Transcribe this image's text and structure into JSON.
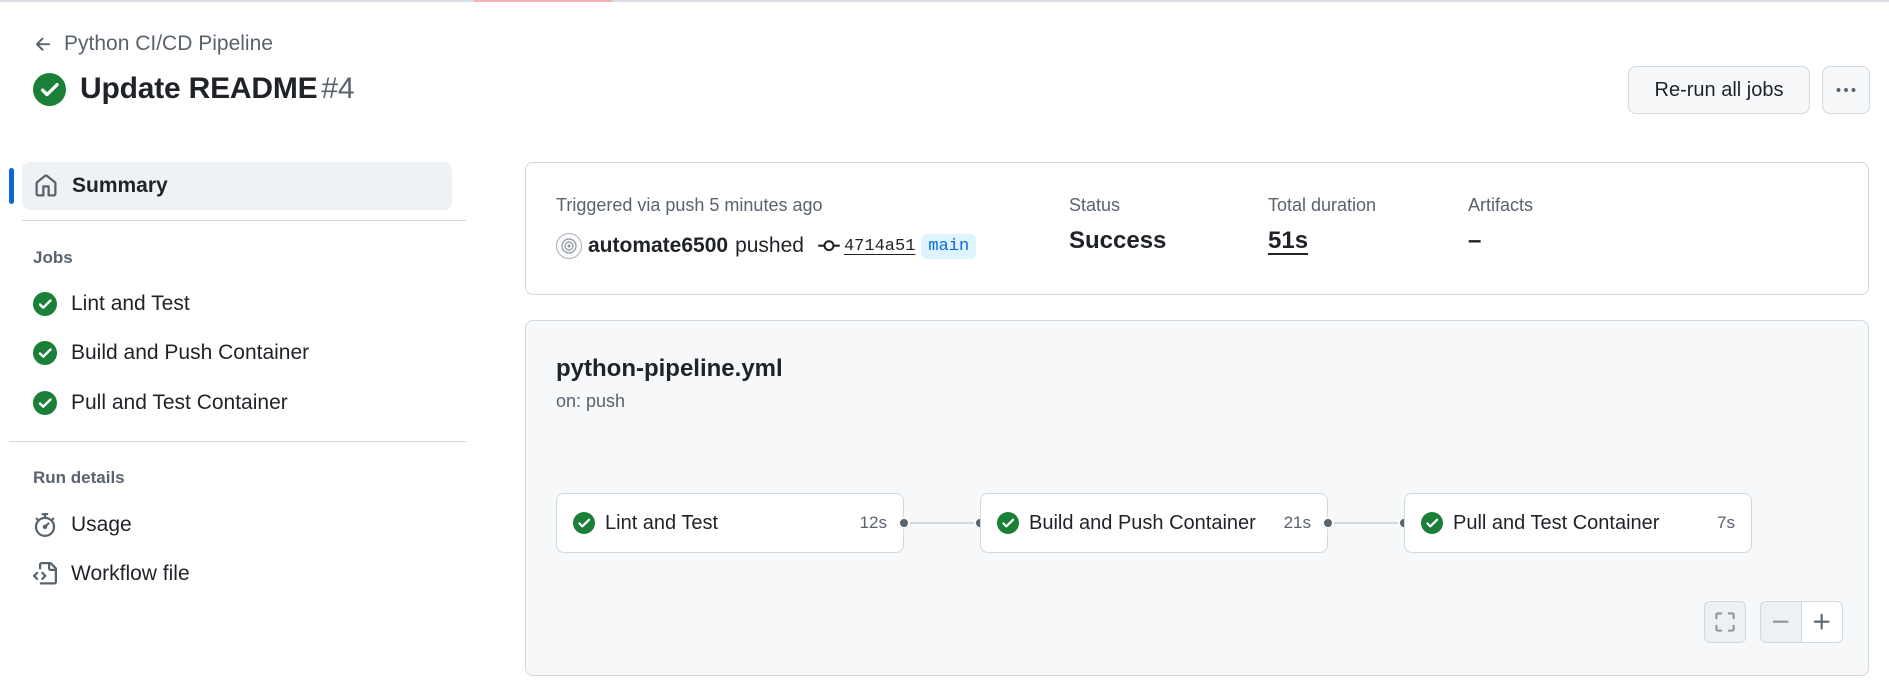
{
  "header": {
    "back_label": "Python CI/CD Pipeline",
    "title": "Update README",
    "run_number": "#4",
    "rerun_label": "Re-run all jobs"
  },
  "sidebar": {
    "summary_label": "Summary",
    "jobs_title": "Jobs",
    "jobs": [
      {
        "label": "Lint and Test"
      },
      {
        "label": "Build and Push Container"
      },
      {
        "label": "Pull and Test Container"
      }
    ],
    "run_details_title": "Run details",
    "run_details": [
      {
        "label": "Usage",
        "icon": "stopwatch-icon"
      },
      {
        "label": "Workflow file",
        "icon": "file-code-icon"
      }
    ]
  },
  "summary": {
    "triggered_text": "Triggered via push 5 minutes ago",
    "actor": "automate6500",
    "action": "pushed",
    "commit_sha": "4714a51",
    "branch": "main",
    "status_label": "Status",
    "status_value": "Success",
    "duration_label": "Total duration",
    "duration_value": "51s",
    "artifacts_label": "Artifacts",
    "artifacts_value": "–"
  },
  "workflow": {
    "file": "python-pipeline.yml",
    "trigger": "on: push",
    "jobs": [
      {
        "name": "Lint and Test",
        "duration": "12s",
        "status": "success"
      },
      {
        "name": "Build and Push Container",
        "duration": "21s",
        "status": "success"
      },
      {
        "name": "Pull and Test Container",
        "duration": "7s",
        "status": "success"
      }
    ]
  },
  "colors": {
    "success": "#1a7f37",
    "accent": "#0969da",
    "branch_bg": "#ddf4ff"
  }
}
